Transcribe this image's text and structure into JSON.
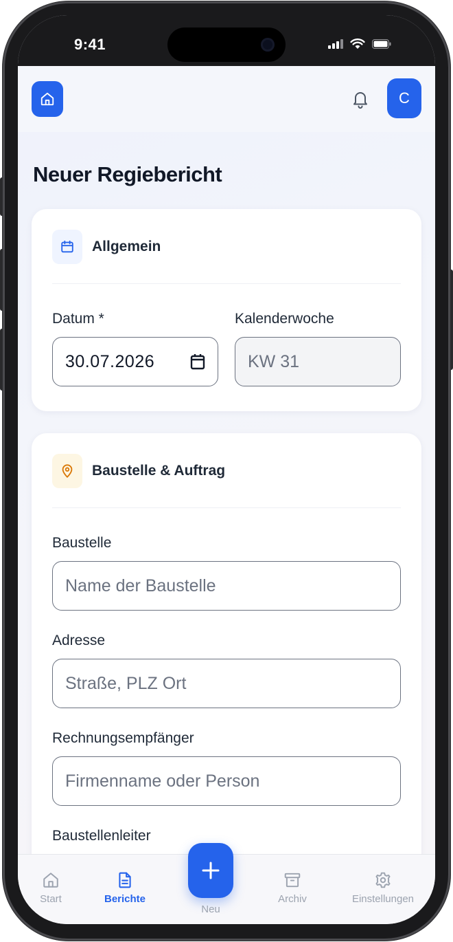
{
  "status_bar": {
    "time": "9:41"
  },
  "header": {
    "avatar_initial": "C"
  },
  "page": {
    "title": "Neuer Regiebericht"
  },
  "section_general": {
    "title": "Allgemein",
    "date_label": "Datum *",
    "date_value": "30.07.2026",
    "week_label": "Kalenderwoche",
    "week_placeholder": "KW 31"
  },
  "section_site": {
    "title": "Baustelle & Auftrag",
    "site_label": "Baustelle",
    "site_placeholder": "Name der Baustelle",
    "address_label": "Adresse",
    "address_placeholder": "Straße, PLZ Ort",
    "recipient_label": "Rechnungsempfänger",
    "recipient_placeholder": "Firmenname oder Person",
    "manager_label": "Baustellenleiter"
  },
  "bottom_nav": {
    "items": [
      {
        "label": "Start",
        "icon": "home-icon",
        "active": false
      },
      {
        "label": "Berichte",
        "icon": "document-icon",
        "active": true
      },
      {
        "label": "Neu",
        "icon": "plus-icon",
        "active": false
      },
      {
        "label": "Archiv",
        "icon": "archive-icon",
        "active": false
      },
      {
        "label": "Einstellungen",
        "icon": "gear-icon",
        "active": false
      }
    ]
  },
  "colors": {
    "accent": "#2563eb",
    "site_icon_bg": "#fdf6e3",
    "site_icon": "#d97706",
    "general_icon_bg": "#eff4ff"
  }
}
